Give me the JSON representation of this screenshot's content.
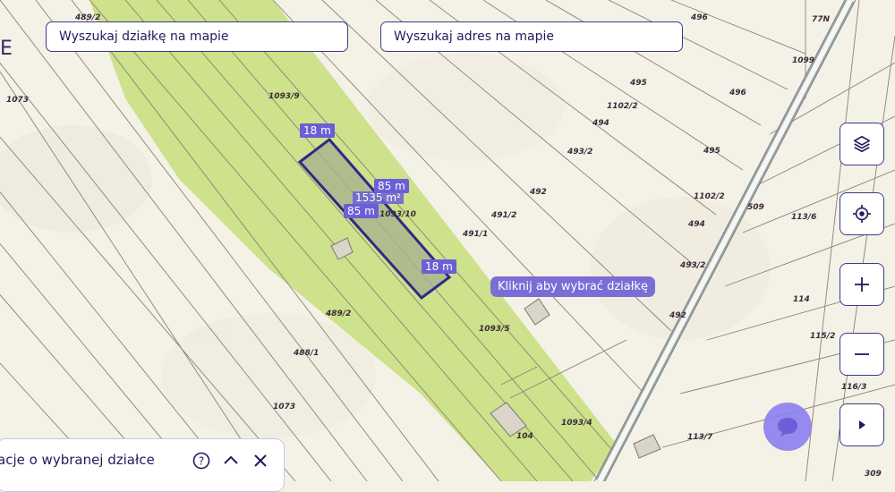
{
  "search": {
    "parcel_placeholder": "Wyszukaj działkę na mapie",
    "address_placeholder": "Wyszukaj adres na mapie"
  },
  "map_controls": {
    "layers": "layers-icon",
    "locate": "crosshair-icon",
    "zoom_in": "+",
    "zoom_out": "−",
    "expand": "▸"
  },
  "tooltip": "Kliknij aby wybrać działkę",
  "selection": {
    "side_top": "18 m",
    "side_upper": "85 m",
    "side_lower": "85 m",
    "side_bottom": "18 m",
    "area": "1535 m²",
    "parcel_id": "1093/10"
  },
  "parcels": [
    "489/2",
    "77N",
    "496",
    "1073",
    "1093/9",
    "1099",
    "495",
    "496",
    "1102/2",
    "494",
    "493/2",
    "495",
    "492",
    "1102/2",
    "491/2",
    "494",
    "509",
    "113/6",
    "491/1",
    "493/2",
    "114",
    "492",
    "489/2",
    "1093/5",
    "115/2",
    "488/1",
    "116/3",
    "1073",
    "1093/4",
    "113/7",
    "104",
    "309"
  ],
  "bottom_panel": {
    "title": "Informacje o wybranej działce",
    "title_visible": "acje o wybranej działce"
  },
  "edge_letter": "E",
  "colors": {
    "map_bg": "#f4f1e6",
    "highlight": "#c7de7a",
    "accent": "#3b3a8c",
    "selection_fill": "#a9b38f",
    "chat": "#8c7ff0"
  }
}
